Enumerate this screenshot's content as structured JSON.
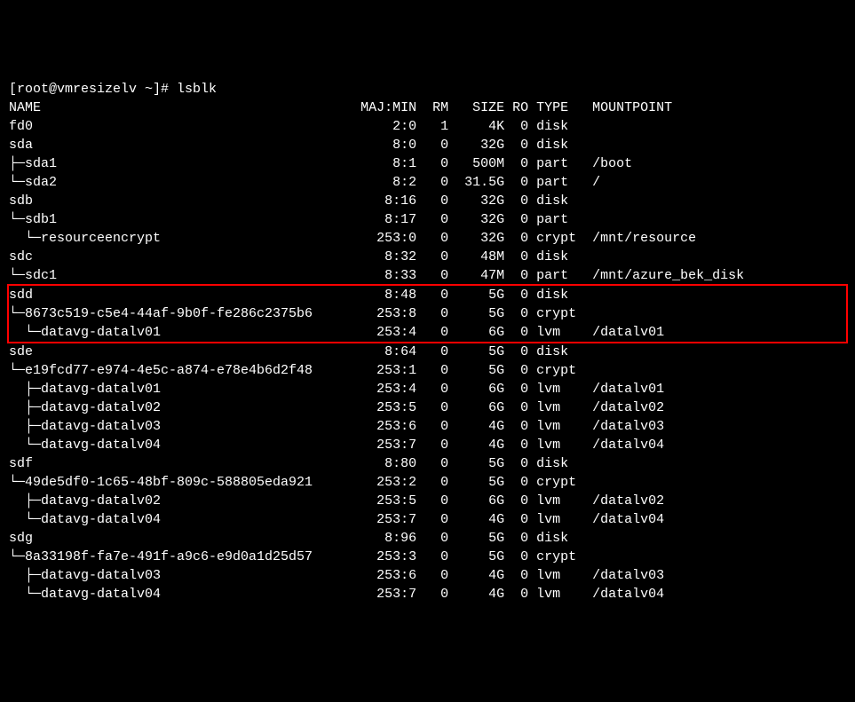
{
  "prompt": "[root@vmresizelv ~]# lsblk",
  "header": {
    "name": "NAME",
    "majmin": "MAJ:MIN",
    "rm": "RM",
    "size": "SIZE",
    "ro": "RO",
    "type": "TYPE",
    "mount": "MOUNTPOINT"
  },
  "rows": [
    {
      "tree": "",
      "name": "fd0",
      "majmin": "2:0",
      "rm": "1",
      "size": "4K",
      "ro": "0",
      "type": "disk",
      "mount": "",
      "hl": false
    },
    {
      "tree": "",
      "name": "sda",
      "majmin": "8:0",
      "rm": "0",
      "size": "32G",
      "ro": "0",
      "type": "disk",
      "mount": "",
      "hl": false
    },
    {
      "tree": "├─",
      "name": "sda1",
      "majmin": "8:1",
      "rm": "0",
      "size": "500M",
      "ro": "0",
      "type": "part",
      "mount": "/boot",
      "hl": false
    },
    {
      "tree": "└─",
      "name": "sda2",
      "majmin": "8:2",
      "rm": "0",
      "size": "31.5G",
      "ro": "0",
      "type": "part",
      "mount": "/",
      "hl": false
    },
    {
      "tree": "",
      "name": "sdb",
      "majmin": "8:16",
      "rm": "0",
      "size": "32G",
      "ro": "0",
      "type": "disk",
      "mount": "",
      "hl": false
    },
    {
      "tree": "└─",
      "name": "sdb1",
      "majmin": "8:17",
      "rm": "0",
      "size": "32G",
      "ro": "0",
      "type": "part",
      "mount": "",
      "hl": false
    },
    {
      "tree": "  └─",
      "name": "resourceencrypt",
      "majmin": "253:0",
      "rm": "0",
      "size": "32G",
      "ro": "0",
      "type": "crypt",
      "mount": "/mnt/resource",
      "hl": false
    },
    {
      "tree": "",
      "name": "sdc",
      "majmin": "8:32",
      "rm": "0",
      "size": "48M",
      "ro": "0",
      "type": "disk",
      "mount": "",
      "hl": false
    },
    {
      "tree": "└─",
      "name": "sdc1",
      "majmin": "8:33",
      "rm": "0",
      "size": "47M",
      "ro": "0",
      "type": "part",
      "mount": "/mnt/azure_bek_disk",
      "hl": false
    },
    {
      "tree": "",
      "name": "sdd",
      "majmin": "8:48",
      "rm": "0",
      "size": "5G",
      "ro": "0",
      "type": "disk",
      "mount": "",
      "hl": true
    },
    {
      "tree": "└─",
      "name": "8673c519-c5e4-44af-9b0f-fe286c2375b6",
      "majmin": "253:8",
      "rm": "0",
      "size": "5G",
      "ro": "0",
      "type": "crypt",
      "mount": "",
      "hl": true
    },
    {
      "tree": "  └─",
      "name": "datavg-datalv01",
      "majmin": "253:4",
      "rm": "0",
      "size": "6G",
      "ro": "0",
      "type": "lvm",
      "mount": "/datalv01",
      "hl": true
    },
    {
      "tree": "",
      "name": "sde",
      "majmin": "8:64",
      "rm": "0",
      "size": "5G",
      "ro": "0",
      "type": "disk",
      "mount": "",
      "hl": false
    },
    {
      "tree": "└─",
      "name": "e19fcd77-e974-4e5c-a874-e78e4b6d2f48",
      "majmin": "253:1",
      "rm": "0",
      "size": "5G",
      "ro": "0",
      "type": "crypt",
      "mount": "",
      "hl": false
    },
    {
      "tree": "  ├─",
      "name": "datavg-datalv01",
      "majmin": "253:4",
      "rm": "0",
      "size": "6G",
      "ro": "0",
      "type": "lvm",
      "mount": "/datalv01",
      "hl": false
    },
    {
      "tree": "  ├─",
      "name": "datavg-datalv02",
      "majmin": "253:5",
      "rm": "0",
      "size": "6G",
      "ro": "0",
      "type": "lvm",
      "mount": "/datalv02",
      "hl": false
    },
    {
      "tree": "  ├─",
      "name": "datavg-datalv03",
      "majmin": "253:6",
      "rm": "0",
      "size": "4G",
      "ro": "0",
      "type": "lvm",
      "mount": "/datalv03",
      "hl": false
    },
    {
      "tree": "  └─",
      "name": "datavg-datalv04",
      "majmin": "253:7",
      "rm": "0",
      "size": "4G",
      "ro": "0",
      "type": "lvm",
      "mount": "/datalv04",
      "hl": false
    },
    {
      "tree": "",
      "name": "sdf",
      "majmin": "8:80",
      "rm": "0",
      "size": "5G",
      "ro": "0",
      "type": "disk",
      "mount": "",
      "hl": false
    },
    {
      "tree": "└─",
      "name": "49de5df0-1c65-48bf-809c-588805eda921",
      "majmin": "253:2",
      "rm": "0",
      "size": "5G",
      "ro": "0",
      "type": "crypt",
      "mount": "",
      "hl": false
    },
    {
      "tree": "  ├─",
      "name": "datavg-datalv02",
      "majmin": "253:5",
      "rm": "0",
      "size": "6G",
      "ro": "0",
      "type": "lvm",
      "mount": "/datalv02",
      "hl": false
    },
    {
      "tree": "  └─",
      "name": "datavg-datalv04",
      "majmin": "253:7",
      "rm": "0",
      "size": "4G",
      "ro": "0",
      "type": "lvm",
      "mount": "/datalv04",
      "hl": false
    },
    {
      "tree": "",
      "name": "sdg",
      "majmin": "8:96",
      "rm": "0",
      "size": "5G",
      "ro": "0",
      "type": "disk",
      "mount": "",
      "hl": false
    },
    {
      "tree": "└─",
      "name": "8a33198f-fa7e-491f-a9c6-e9d0a1d25d57",
      "majmin": "253:3",
      "rm": "0",
      "size": "5G",
      "ro": "0",
      "type": "crypt",
      "mount": "",
      "hl": false
    },
    {
      "tree": "  ├─",
      "name": "datavg-datalv03",
      "majmin": "253:6",
      "rm": "0",
      "size": "4G",
      "ro": "0",
      "type": "lvm",
      "mount": "/datalv03",
      "hl": false
    },
    {
      "tree": "  └─",
      "name": "datavg-datalv04",
      "majmin": "253:7",
      "rm": "0",
      "size": "4G",
      "ro": "0",
      "type": "lvm",
      "mount": "/datalv04",
      "hl": false
    }
  ],
  "cols": {
    "name_w": 44,
    "majmin_w": 7,
    "rm_w": 3,
    "size_w": 7,
    "ro_w": 3,
    "type_w": 6
  }
}
